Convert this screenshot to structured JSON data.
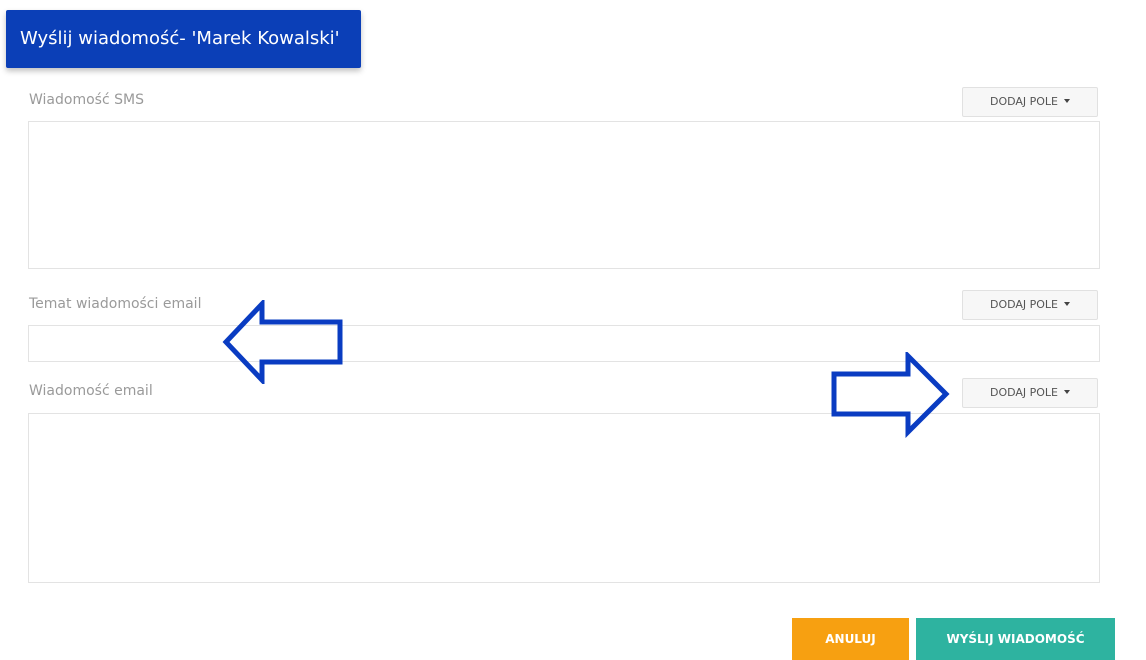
{
  "header": {
    "title": "Wyślij wiadomość- 'Marek Kowalski'"
  },
  "sms": {
    "label": "Wiadomość SMS",
    "add_field_label": "DODAJ POLE",
    "value": ""
  },
  "email_subject": {
    "label": "Temat wiadomości email",
    "add_field_label": "DODAJ POLE",
    "value": ""
  },
  "email_body": {
    "label": "Wiadomość email",
    "add_field_label": "DODAJ POLE",
    "value": ""
  },
  "actions": {
    "cancel_label": "ANULUJ",
    "send_label": "WYŚLIJ WIADOMOŚĆ"
  },
  "annotations": {
    "left_arrow_icon": "arrow-left-outline",
    "right_arrow_icon": "arrow-right-outline"
  },
  "colors": {
    "header_bg": "#0b3fb7",
    "cancel_bg": "#f7a011",
    "send_bg": "#2eb3a0",
    "arrow_stroke": "#0a3cc2"
  }
}
